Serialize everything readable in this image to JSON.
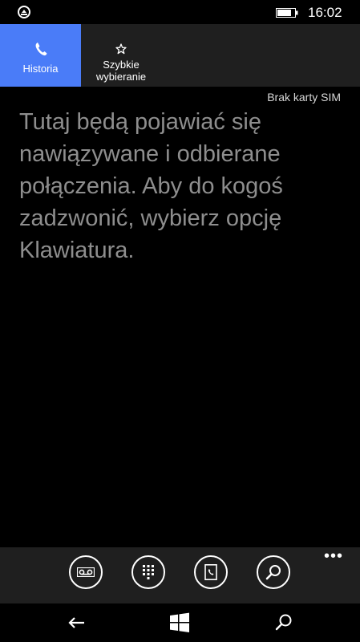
{
  "status_bar": {
    "time": "16:02",
    "battery_icon": "battery-icon",
    "app_icon": "notification-icon"
  },
  "tabs": [
    {
      "label": "Historia",
      "icon": "phone-icon",
      "active": true
    },
    {
      "label": "Szybkie wybieranie",
      "icon": "star-icon",
      "active": false
    }
  ],
  "content": {
    "sim_status": "Brak karty SIM",
    "empty_message": "Tutaj będą pojawiać się nawiązywane i odbierane połączenia. Aby do kogoś zadzwonić, wybierz opcję Klawiatura."
  },
  "app_bar": {
    "buttons": [
      "voicemail-icon",
      "keypad-icon",
      "contacts-icon",
      "search-icon"
    ],
    "more": "•••"
  },
  "nav_bar": {
    "buttons": [
      "back-icon",
      "windows-start-icon",
      "search-icon"
    ]
  },
  "colors": {
    "accent": "#4a7cf8",
    "tab_background": "#1f1f1f",
    "background": "#000000",
    "message_text": "#8e8e8e"
  }
}
